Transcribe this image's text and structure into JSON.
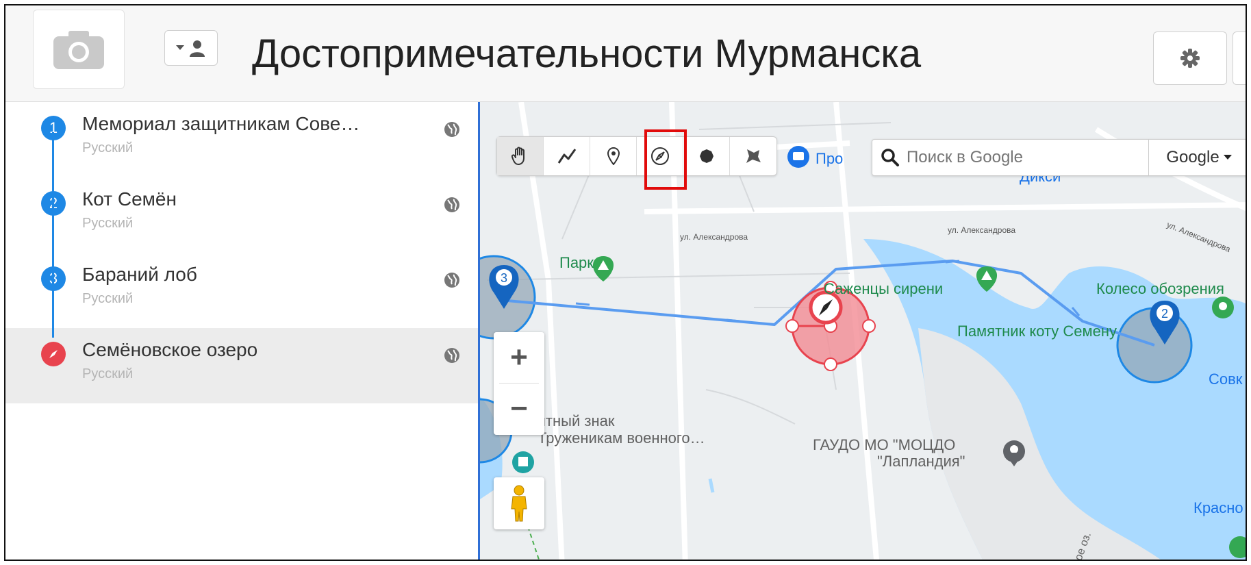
{
  "header": {
    "title": "Достопримечательности Мурманска",
    "camera_icon": "camera-icon",
    "user_dropdown_icon": "user-icon",
    "settings_icon": "gear-icon"
  },
  "sidebar": {
    "items": [
      {
        "number": "1",
        "title": "Мемориал защитникам Сове…",
        "language": "Русский",
        "marker": "blue"
      },
      {
        "number": "2",
        "title": "Кот Семён",
        "language": "Русский",
        "marker": "blue"
      },
      {
        "number": "3",
        "title": "Бараний лоб",
        "language": "Русский",
        "marker": "blue"
      },
      {
        "number": "",
        "title": "Семёновское озеро",
        "language": "Русский",
        "marker": "red-compass",
        "active": true
      }
    ],
    "accent": "#1e88e5",
    "active_marker_color": "#e8434e"
  },
  "map": {
    "search_placeholder": "Поиск в Google",
    "search_engine": "Google",
    "zoom_in": "+",
    "zoom_out": "−",
    "drawing_tools": [
      "hand-icon",
      "polyline-icon",
      "pin-icon",
      "compass-icon",
      "circle-icon",
      "polygon-icon"
    ],
    "highlighted_tool": "compass-icon",
    "pins": [
      "3",
      "2"
    ],
    "labels": {
      "park": "Парк",
      "lilac": "Саженцы сирени",
      "wheel": "Колесо обозрения",
      "cat_monument": "Памятник коту Семену",
      "sign_line1": "ятный знак",
      "sign_line2": "Труженикам военного…",
      "gaudo_line1": "ГАУДО МО \"МОЦДО",
      "gaudo_line2": "\"Лапландия\"",
      "street1": "ул. Александрова",
      "street2": "ул. Александрова",
      "street3": "ул. Александрова",
      "diksi": "Дикси",
      "pro": "Про",
      "sovk": "Совк",
      "krasno": "Красно",
      "lake_text": "ое оз."
    }
  }
}
